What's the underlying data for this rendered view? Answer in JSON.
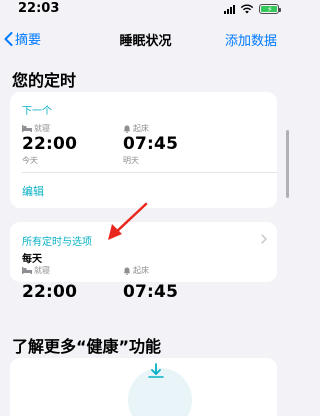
{
  "status_bar": {
    "time": "22:03"
  },
  "nav": {
    "back_label": "摘要",
    "title": "睡眠状况",
    "add_label": "添加数据"
  },
  "section_schedule": "您的定时",
  "next_card": {
    "heading": "下一个",
    "bedtime": {
      "label": "就寝",
      "time": "22:00",
      "day": "今天"
    },
    "wake": {
      "label": "起床",
      "time": "07:45",
      "day": "明天"
    },
    "edit_label": "编辑"
  },
  "all_card": {
    "heading": "所有定时与选项",
    "frequency": "每天",
    "bedtime": {
      "label": "就寝",
      "time": "22:00"
    },
    "wake": {
      "label": "起床",
      "time": "07:45"
    }
  },
  "section_learn": "了解更多“健康”功能",
  "colors": {
    "accent": "#08b0c5",
    "link": "#007aff",
    "annotation": "#e8281e"
  }
}
